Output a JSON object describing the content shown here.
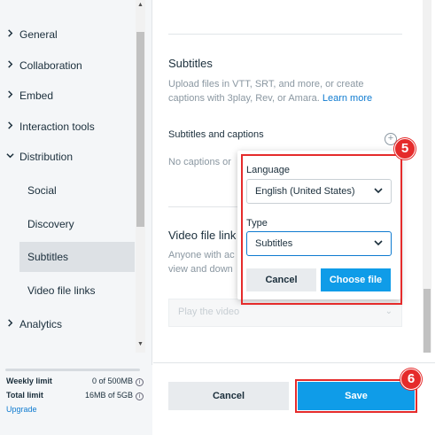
{
  "sidebar": {
    "items": [
      {
        "label": "General",
        "chevron": "right"
      },
      {
        "label": "Collaboration",
        "chevron": "right"
      },
      {
        "label": "Embed",
        "chevron": "right"
      },
      {
        "label": "Interaction tools",
        "chevron": "right"
      },
      {
        "label": "Distribution",
        "chevron": "down"
      }
    ],
    "sub_items": [
      {
        "label": "Social"
      },
      {
        "label": "Discovery"
      },
      {
        "label": "Subtitles",
        "active": true
      },
      {
        "label": "Video file links"
      }
    ],
    "analytics": {
      "label": "Analytics",
      "chevron": "right"
    }
  },
  "limits": {
    "weekly_label": "Weekly limit",
    "weekly_value": "0 of 500MB",
    "total_label": "Total limit",
    "total_value": "16MB of 5GB",
    "upgrade": "Upgrade"
  },
  "main": {
    "subtitles_heading": "Subtitles",
    "subtitles_desc": "Upload files in VTT, SRT, and more, or create captions with 3play, Rev, or Amara.",
    "learn_more": "Learn more",
    "captions_heading": "Subtitles and captions",
    "no_captions": "No captions or",
    "video_file_heading": "Video file link",
    "video_file_desc_1": "Anyone with ac",
    "video_file_desc_2": "view and down",
    "play_placeholder": "Play the video"
  },
  "popup": {
    "language_label": "Language",
    "language_value": "English (United States)",
    "type_label": "Type",
    "type_value": "Subtitles",
    "cancel": "Cancel",
    "choose_file": "Choose file"
  },
  "footer": {
    "cancel": "Cancel",
    "save": "Save"
  },
  "annotations": {
    "step_5": "5",
    "step_6": "6"
  },
  "colors": {
    "accent": "#0f9ce8",
    "link": "#0f7bd0",
    "highlight": "#e52b2b"
  }
}
